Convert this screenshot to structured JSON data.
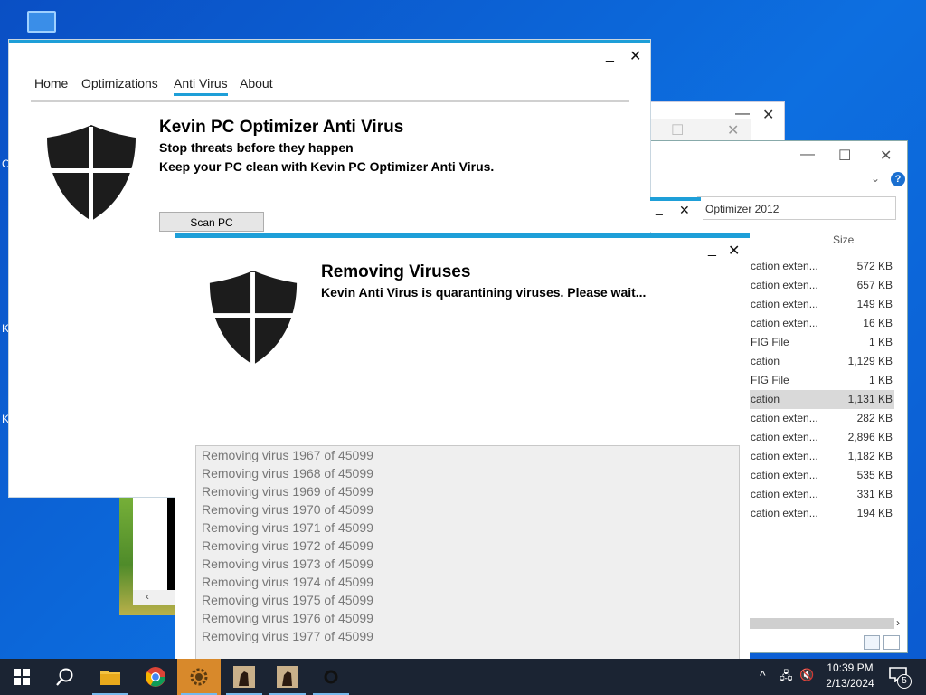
{
  "desktop": {
    "edge_letters": [
      "O",
      "K",
      "K"
    ]
  },
  "explorer": {
    "search_text": "Optimizer 2012",
    "size_header": "Size",
    "rows": [
      {
        "type": "cation exten...",
        "size": "572 KB"
      },
      {
        "type": "cation exten...",
        "size": "657 KB"
      },
      {
        "type": "cation exten...",
        "size": "149 KB"
      },
      {
        "type": "cation exten...",
        "size": "16 KB"
      },
      {
        "type": "FIG File",
        "size": "1 KB"
      },
      {
        "type": "cation",
        "size": "1,129 KB"
      },
      {
        "type": "FIG File",
        "size": "1 KB"
      },
      {
        "type": "cation",
        "size": "1,131 KB",
        "selected": true
      },
      {
        "type": "cation exten...",
        "size": "282 KB"
      },
      {
        "type": "cation exten...",
        "size": "2,896 KB"
      },
      {
        "type": "cation exten...",
        "size": "1,182 KB"
      },
      {
        "type": "cation exten...",
        "size": "535 KB"
      },
      {
        "type": "cation exten...",
        "size": "331 KB"
      },
      {
        "type": "cation exten...",
        "size": "194 KB"
      }
    ]
  },
  "main_window": {
    "nav": [
      "Home",
      "Optimizations",
      "Anti Virus",
      "About"
    ],
    "active_nav": "Anti Virus",
    "title": "Kevin PC Optimizer Anti Virus",
    "subtitle1": "Stop threats before they happen",
    "subtitle2": "Keep your PC clean with Kevin PC Optimizer Anti Virus.",
    "scan_button": "Scan PC",
    "minimize": "_",
    "close": "✕"
  },
  "dialog": {
    "title": "Removing Viruses",
    "subtitle": "Kevin Anti Virus is quarantining viruses. Please wait...",
    "minimize": "_",
    "close": "✕",
    "log": [
      "Removing virus 1967 of 45099",
      "Removing virus 1968 of 45099",
      "Removing virus 1969 of 45099",
      "Removing virus 1970 of 45099",
      "Removing virus 1971 of 45099",
      "Removing virus 1972 of 45099",
      "Removing virus 1973 of 45099",
      "Removing virus 1974 of 45099",
      "Removing virus 1975 of 45099",
      "Removing virus 1976 of 45099",
      "Removing virus 1977 of 45099"
    ]
  },
  "taskbar": {
    "time": "10:39 PM",
    "date": "2/13/2024",
    "notification_count": "5"
  },
  "colors": {
    "accent": "#1e9fd8",
    "taskbar": "#1b2433",
    "desktop": "#0d6fe0"
  }
}
